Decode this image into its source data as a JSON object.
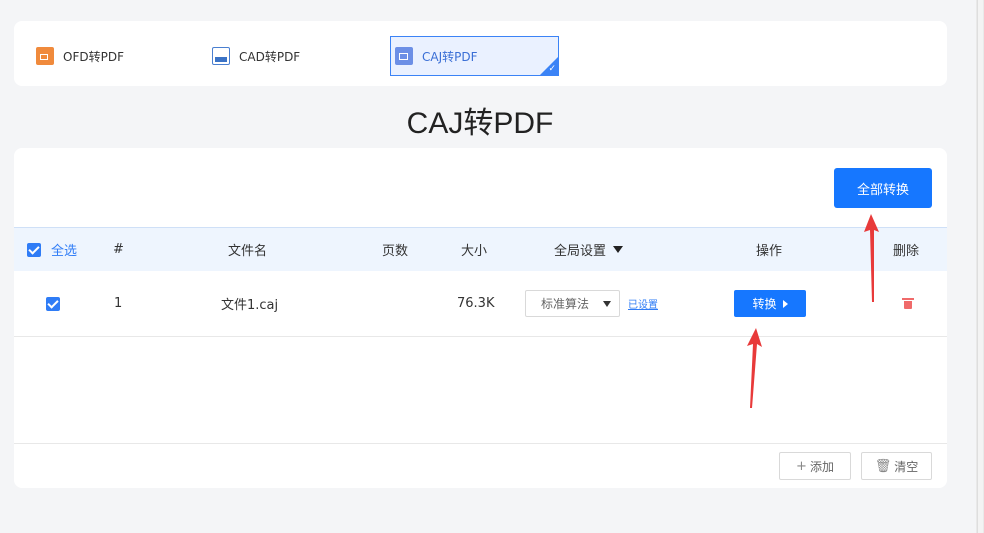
{
  "tabs": [
    {
      "label": "OFD转PDF",
      "icon": "ofd-file-icon"
    },
    {
      "label": "CAD转PDF",
      "icon": "cad-file-icon"
    },
    {
      "label": "CAJ转PDF",
      "icon": "caj-file-icon",
      "active": true
    }
  ],
  "page_title": "CAJ转PDF",
  "toolbar": {
    "convert_all_label": "全部转换"
  },
  "table": {
    "headers": {
      "select_all": "全选",
      "index": "#",
      "filename": "文件名",
      "pages": "页数",
      "size": "大小",
      "global_settings": "全局设置",
      "action": "操作",
      "delete": "删除"
    },
    "rows": [
      {
        "checked": true,
        "index": "1",
        "filename": "文件1.caj",
        "pages": "",
        "size": "76.3K",
        "algorithm": "标准算法",
        "settings_link": "已设置",
        "convert_label": "转换"
      }
    ]
  },
  "footer": {
    "add_label": "添加",
    "clear_label": "清空"
  },
  "colors": {
    "accent": "#1677ff",
    "annotation_arrow": "#e83a3a",
    "delete": "#f06a6a"
  }
}
